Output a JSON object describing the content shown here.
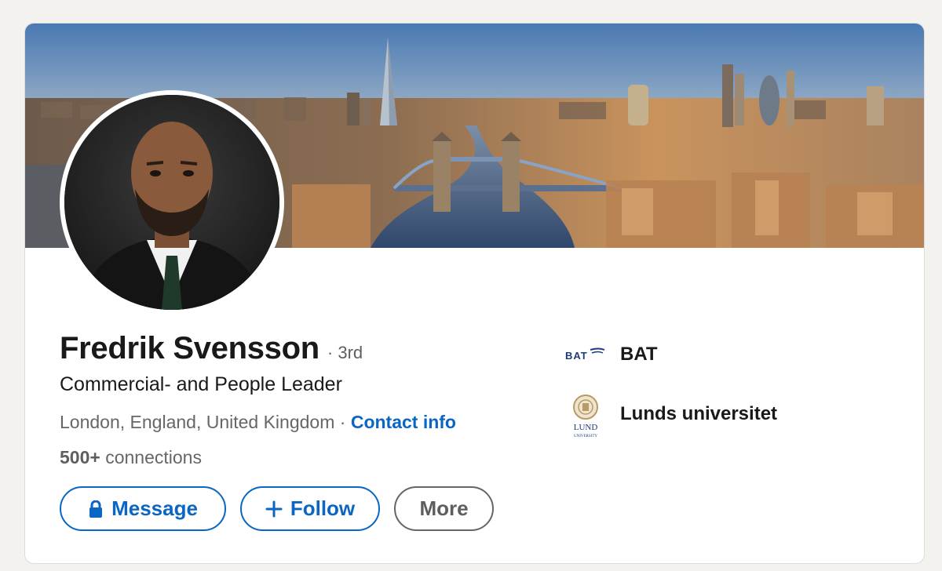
{
  "profile": {
    "name": "Fredrik Svensson",
    "degree": "· 3rd",
    "headline": "Commercial- and People Leader",
    "location": "London, England, United Kingdom",
    "separator": " · ",
    "contact_info_label": "Contact info",
    "connections_count": "500+",
    "connections_label": " connections"
  },
  "actions": {
    "message_label": "Message",
    "follow_label": "Follow",
    "more_label": "More"
  },
  "experience": [
    {
      "name": "BAT",
      "logo_text": "BAT"
    },
    {
      "name": "Lunds universitet",
      "logo_text": "LUND",
      "logo_subtext": "UNIVERSITY"
    }
  ],
  "colors": {
    "accent": "#0a66c2",
    "text_primary": "#191919",
    "text_secondary": "#666666",
    "background": "#f3f2ef"
  },
  "icons": {
    "message": "lock-icon",
    "follow": "plus-icon"
  }
}
